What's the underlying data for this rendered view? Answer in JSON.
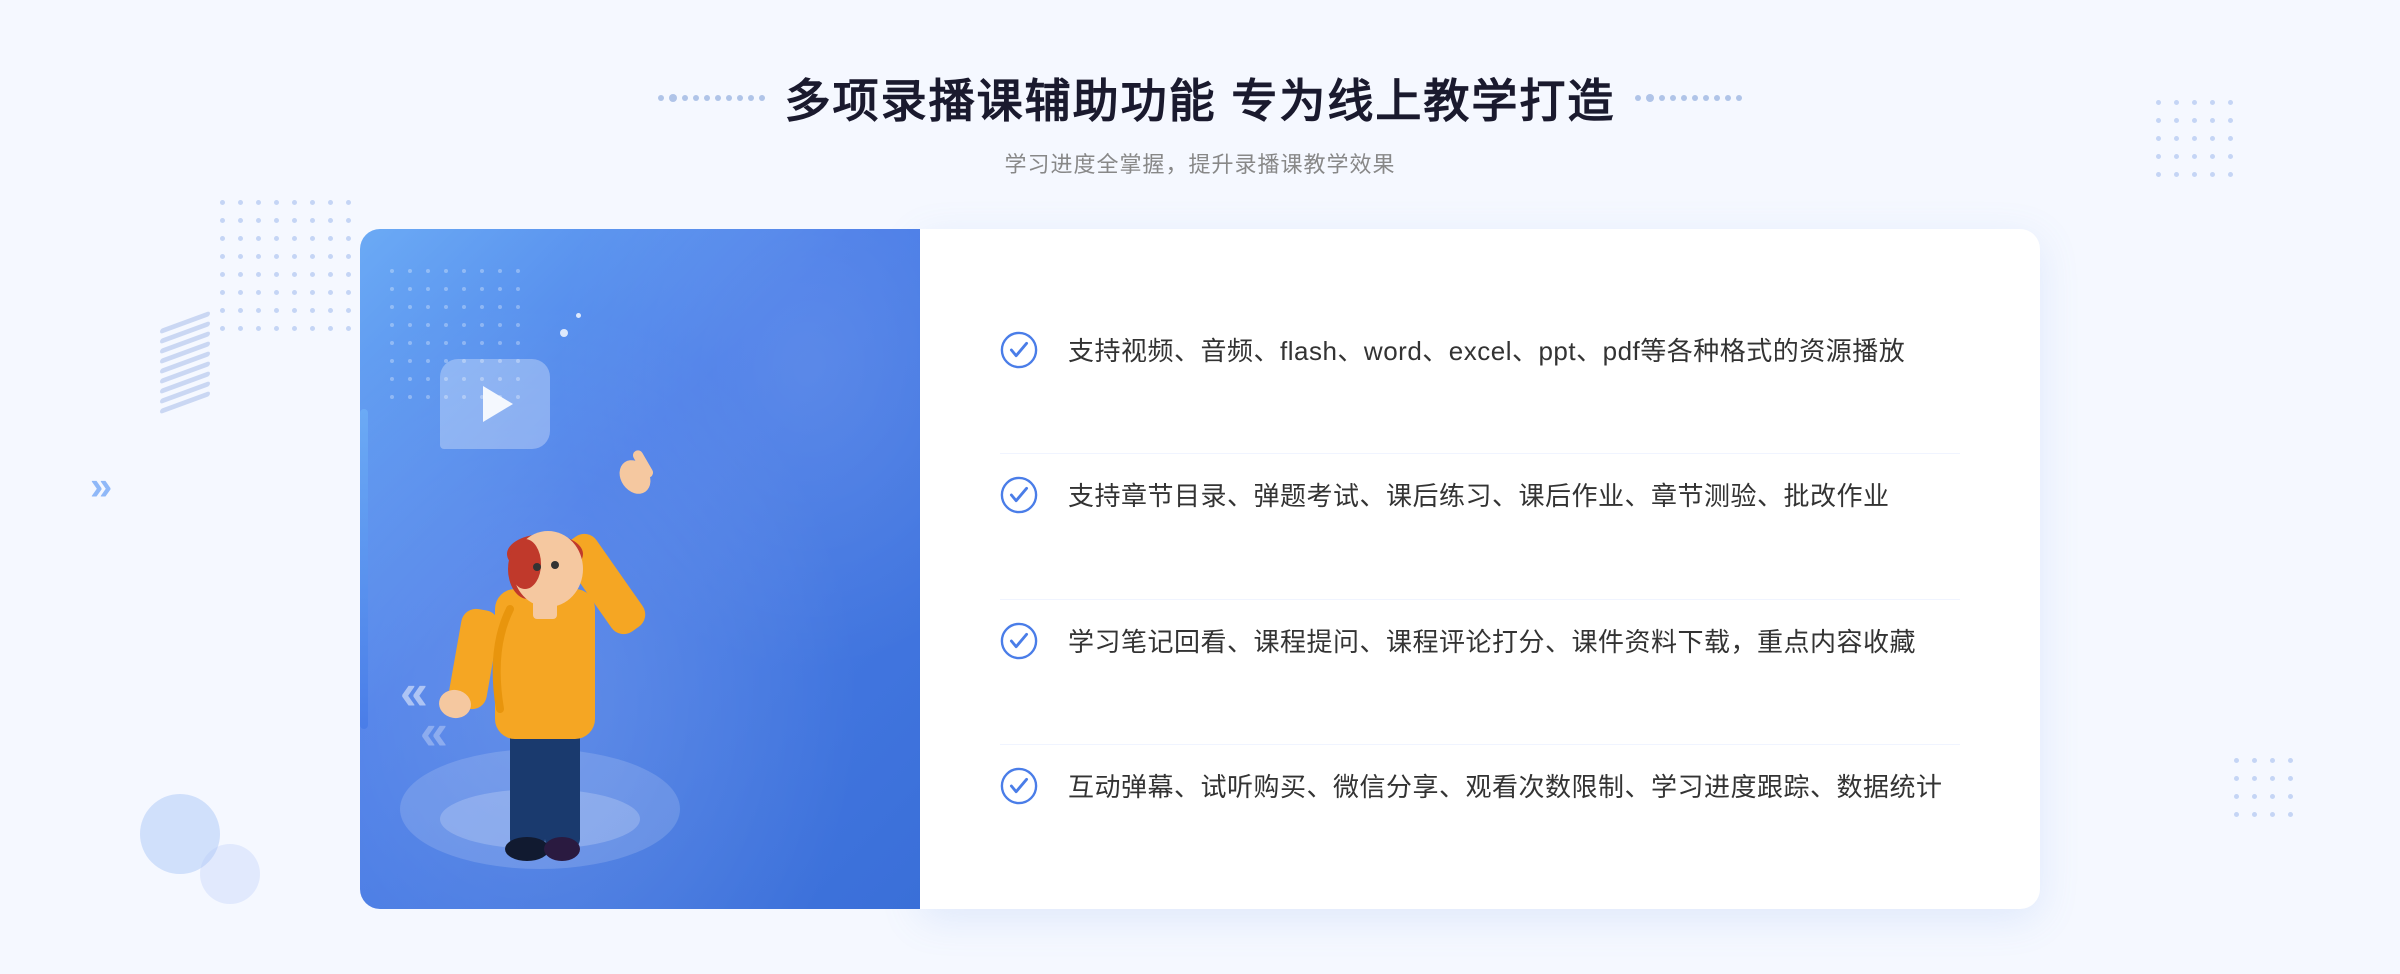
{
  "page": {
    "background_color": "#f0f5ff"
  },
  "header": {
    "title": "多项录播课辅助功能 专为线上教学打造",
    "subtitle": "学习进度全掌握，提升录播课教学效果",
    "deco_left": "«",
    "deco_right": "»"
  },
  "features": [
    {
      "id": 1,
      "text": "支持视频、音频、flash、word、excel、ppt、pdf等各种格式的资源播放"
    },
    {
      "id": 2,
      "text": "支持章节目录、弹题考试、课后练习、课后作业、章节测验、批改作业"
    },
    {
      "id": 3,
      "text": "学习笔记回看、课程提问、课程评论打分、课件资料下载，重点内容收藏"
    },
    {
      "id": 4,
      "text": "互动弹幕、试听购买、微信分享、观看次数限制、学习进度跟踪、数据统计"
    }
  ],
  "illustration": {
    "play_bubble_visible": true
  },
  "colors": {
    "primary_blue": "#4a7de8",
    "light_blue": "#6baaf5",
    "check_color": "#4a7de8",
    "text_dark": "#333333",
    "text_gray": "#888888",
    "title_color": "#1a1a2e"
  }
}
